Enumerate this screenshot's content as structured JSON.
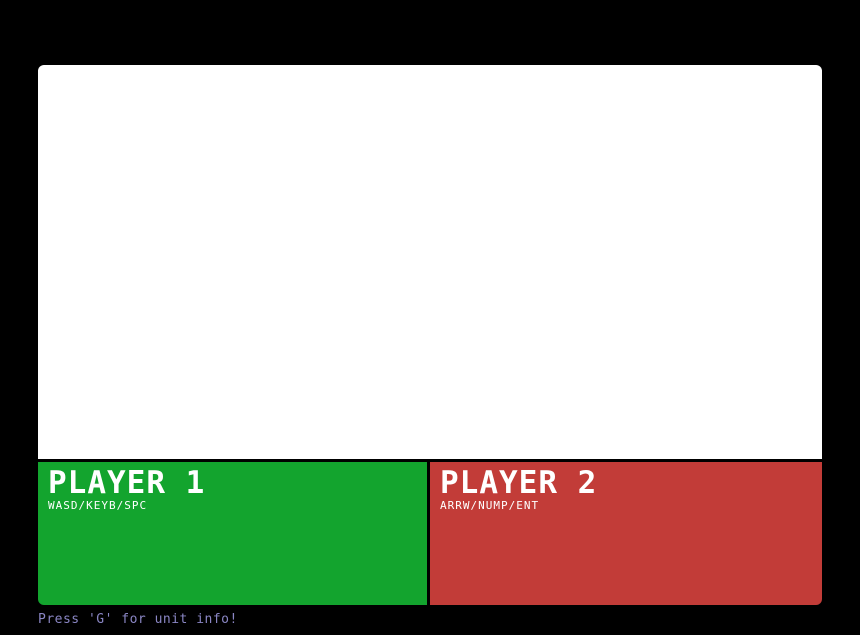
{
  "game": {
    "colors": {
      "background": "#000000",
      "play_area": "#ffffff",
      "player1": "#13a42e",
      "player2": "#c23c38",
      "hint_text": "#8a86c4"
    },
    "players": [
      {
        "title": "PLAYER 1",
        "controls": "WASD/KEYB/SPC"
      },
      {
        "title": "PLAYER 2",
        "controls": "ARRW/NUMP/ENT"
      }
    ],
    "hint": "Press 'G' for unit info!"
  }
}
